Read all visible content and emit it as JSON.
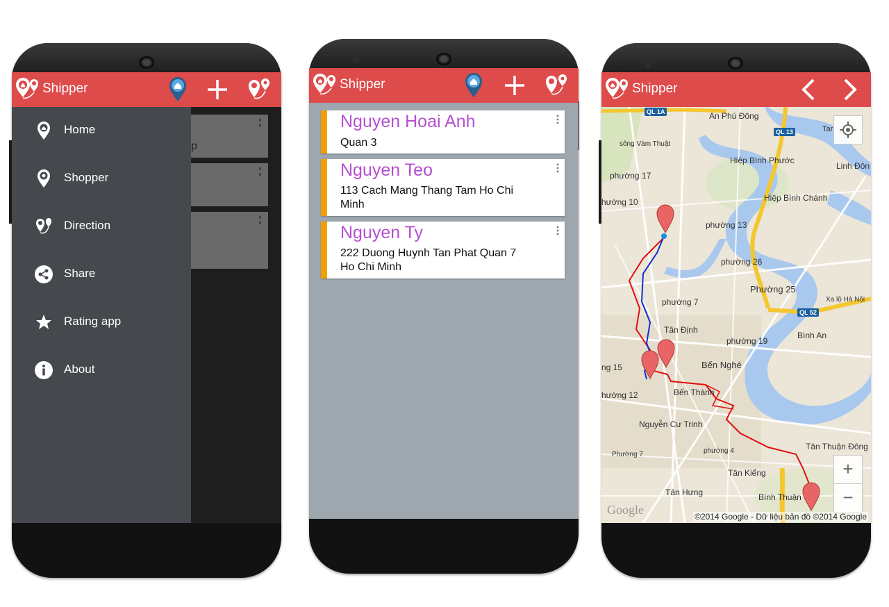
{
  "app": {
    "title": "Shipper"
  },
  "drawer": {
    "items": [
      {
        "label": "Home",
        "icon": "home-pin-icon"
      },
      {
        "label": "Shopper",
        "icon": "shopper-pin-icon"
      },
      {
        "label": "Direction",
        "icon": "direction-icon"
      },
      {
        "label": "Share",
        "icon": "share-icon"
      },
      {
        "label": "Rating app",
        "icon": "star-icon"
      },
      {
        "label": "About",
        "icon": "info-icon"
      }
    ],
    "behind_card_fragment": "p"
  },
  "list": {
    "items": [
      {
        "name": "Nguyen Hoai Anh",
        "address": "Quan 3"
      },
      {
        "name": "Nguyen Teo",
        "address": "113 Cach Mang Thang Tam Ho Chi Minh"
      },
      {
        "name": "Nguyen Ty",
        "address": "222 Duong Huynh Tan Phat Quan 7 Ho Chi Minh"
      }
    ]
  },
  "map": {
    "labels": [
      "An Phú Đông",
      "sông Vàm Thuật",
      "Hiệp Bình Phước",
      "Linh Đôn",
      "phường 17",
      "Hiệp Bình Chánh",
      "hường 10",
      "phường 13",
      "phường 26",
      "Phường 25",
      "Xa lộ Hà Nội",
      "phường 7",
      "Tân Định",
      "phường 19",
      "Bình An",
      "Bến Nghé",
      "ng 15",
      "hường 12",
      "Bến Thành",
      "Nguyễn Cư Trinh",
      "Tân Thuận Đông",
      "Phường 7",
      "phường 4",
      "Tân Kiểng",
      "Tân Hưng",
      "Bình Thuận",
      "Tar"
    ],
    "shields": [
      "QL 1A",
      "QL 13",
      "QL 52"
    ],
    "google_logo": "Google",
    "attribution": "©2014 Google - Dữ liệu bản đồ ©2014 Google",
    "zoom_in": "+",
    "zoom_out": "−"
  },
  "colors": {
    "appbar": "#de4b4b",
    "drawer": "#45494e",
    "accent_bar": "#f0a000",
    "name_text": "#b54fd0",
    "list_bg": "#9ea6ae",
    "route_red": "#e01010",
    "route_blue": "#1030d0"
  }
}
